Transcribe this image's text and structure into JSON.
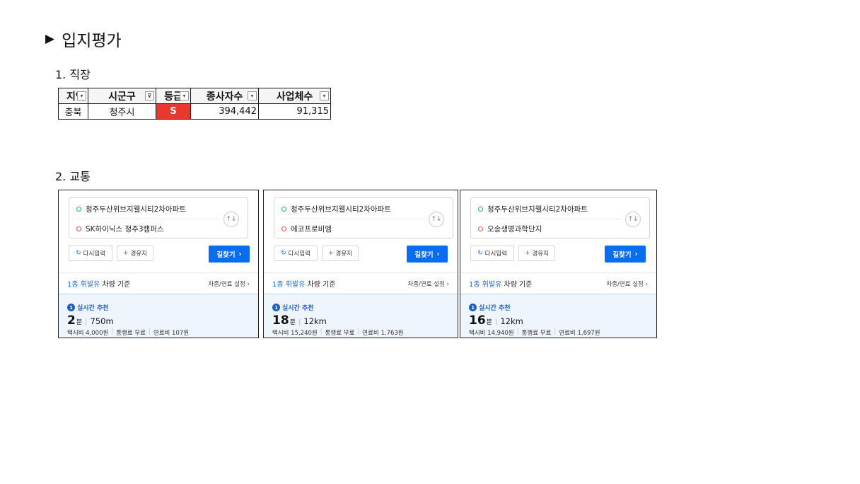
{
  "section_title": "입지평가",
  "sub1": "1. 직장",
  "sub2": "2. 교통",
  "table": {
    "headers": [
      "지역",
      "시군구",
      "등급",
      "종사자수",
      "사업체수"
    ],
    "row": {
      "region": "충북",
      "city": "청주시",
      "grade": "S",
      "employees": "394,442",
      "businesses": "91,315"
    },
    "grade_color": "#e8382f"
  },
  "cards": [
    {
      "from": "청주두산위브지웰시티2차아파트",
      "to": "SK하이닉스 청주3캠퍼스",
      "reset": "다시입력",
      "via": "경유지",
      "go": "길찾기",
      "fuel_type": "1종 휘발유",
      "fuel_suffix": " 차량 기준",
      "settings": "차종/연료 설정",
      "rec_num": "1",
      "rec_label": "실시간 추천",
      "time": "2",
      "time_unit": "분",
      "distance": "750m",
      "taxi": "택시비 4,000원",
      "toll": "통행료 무료",
      "fuel": "연료비 107원"
    },
    {
      "from": "청주두산위브지웰시티2차아파트",
      "to": "에코프로비엠",
      "reset": "다시입력",
      "via": "경유지",
      "go": "길찾기",
      "fuel_type": "1종 휘발유",
      "fuel_suffix": " 차량 기준",
      "settings": "차종/연료 설정",
      "rec_num": "1",
      "rec_label": "실시간 추천",
      "time": "18",
      "time_unit": "분",
      "distance": "12km",
      "taxi": "택시비 15,240원",
      "toll": "통행료 무료",
      "fuel": "연료비 1,763원"
    },
    {
      "from": "청주두산위브지웰시티2차아파트",
      "to": "오송생명과학단지",
      "reset": "다시입력",
      "via": "경유지",
      "go": "길찾기",
      "fuel_type": "1종 휘발유",
      "fuel_suffix": " 차량 기준",
      "settings": "차종/연료 설정",
      "rec_num": "1",
      "rec_label": "실시간 추천",
      "time": "16",
      "time_unit": "분",
      "distance": "12km",
      "taxi": "택시비 14,940원",
      "toll": "통행료 무료",
      "fuel": "연료비 1,697원"
    }
  ]
}
